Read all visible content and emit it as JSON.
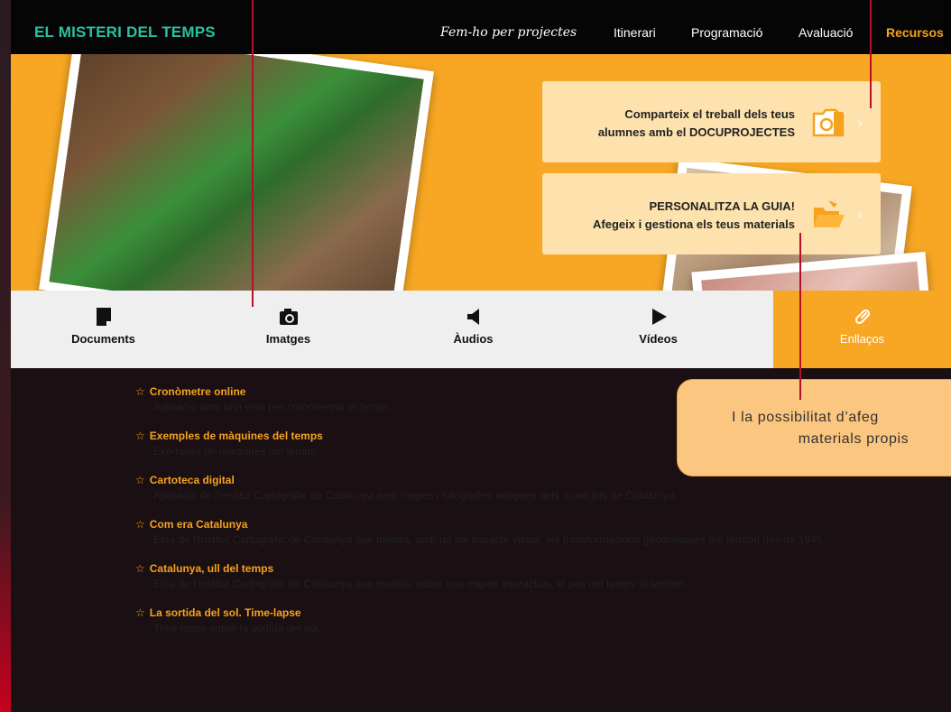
{
  "header": {
    "brand": "EL MISTERI DEL TEMPS",
    "nav": [
      {
        "label": "Fem-ho per projectes"
      },
      {
        "label": "Itinerari"
      },
      {
        "label": "Programació"
      },
      {
        "label": "Avaluació"
      },
      {
        "label": "Recursos"
      }
    ],
    "active_color": "#f6a21e",
    "brand_color": "#2bc0a2"
  },
  "hero": {
    "background_color": "#f7a723",
    "cards": [
      {
        "line1": "Comparteix el treball dels teus",
        "line2": "alumnes amb el DOCUPROJECTES",
        "icon": "camera-folder-icon"
      },
      {
        "line1": "PERSONALITZA LA GUIA!",
        "line2": "Afegeix i gestiona els teus materials",
        "icon": "open-folder-icon"
      }
    ]
  },
  "tabs": [
    {
      "label": "Documents",
      "icon": "document-icon"
    },
    {
      "label": "Imatges",
      "icon": "camera-icon"
    },
    {
      "label": "Àudios",
      "icon": "speaker-icon"
    },
    {
      "label": "Vídeos",
      "icon": "play-icon"
    },
    {
      "label": "Enllaços",
      "icon": "link-icon"
    }
  ],
  "links": [
    {
      "title": "Cronòmetre online",
      "desc": "Aplicació amb una eina per cronometrar el temps."
    },
    {
      "title": "Exemples de màquines del temps",
      "desc": "Exemples de màquines del temps."
    },
    {
      "title": "Cartoteca digital",
      "desc": "Aplicació de l'Institut Cartogràfic de Catalunya amb mapes i fotografies antigues dels municipis de Catalunya."
    },
    {
      "title": "Com era Catalunya",
      "desc": "Eina de l'Institut Cartogràfic de Catalunya que mostra, amb un sol impacte visual, les transformacions geogràfiques del territori des de 1945."
    },
    {
      "title": "Catalunya, ull del temps",
      "desc": "Eina de l'Institut Cartogràfic de Catalunya que mostra, sobre uns mapes interactius, el pas del temps al territori."
    },
    {
      "title": "La sortida del sol. Time-lapse",
      "desc": "Time-lapse sobre la sortida del sol."
    }
  ],
  "callout": {
    "line1": "I la possibilitat d’afeg",
    "line2": "materials propis"
  }
}
